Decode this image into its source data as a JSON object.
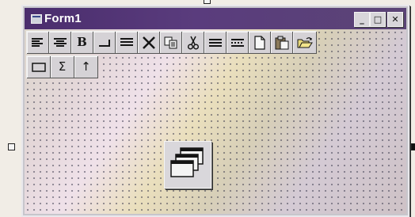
{
  "window": {
    "title": "Form1",
    "title_bar_color": "#4a2d6d",
    "controls": {
      "minimize_icon": "minimize-icon",
      "maximize_icon": "maximize-icon",
      "close_icon": "close-icon",
      "minimize_glyph": "_",
      "maximize_glyph": "□",
      "close_glyph": "✕"
    }
  },
  "toolbar": {
    "row1": [
      {
        "icon": "align-left-icon"
      },
      {
        "icon": "align-center-icon"
      },
      {
        "icon": "bold-icon",
        "text": "B"
      },
      {
        "icon": "line-corner-icon"
      },
      {
        "icon": "justify-icon"
      },
      {
        "icon": "delete-icon"
      },
      {
        "icon": "copy-icon"
      },
      {
        "icon": "cut-icon"
      },
      {
        "icon": "horizontal-lines-icon"
      },
      {
        "icon": "dashed-lines-icon"
      },
      {
        "icon": "new-document-icon"
      },
      {
        "icon": "paste-icon"
      },
      {
        "icon": "open-folder-icon"
      }
    ],
    "row2": [
      {
        "icon": "rectangle-icon"
      },
      {
        "icon": "sum-icon",
        "text": "Σ"
      },
      {
        "icon": "up-arrow-icon",
        "text": "↑"
      }
    ]
  },
  "form_canvas": {
    "grid": true,
    "control_icon": "stacked-windows-icon"
  }
}
